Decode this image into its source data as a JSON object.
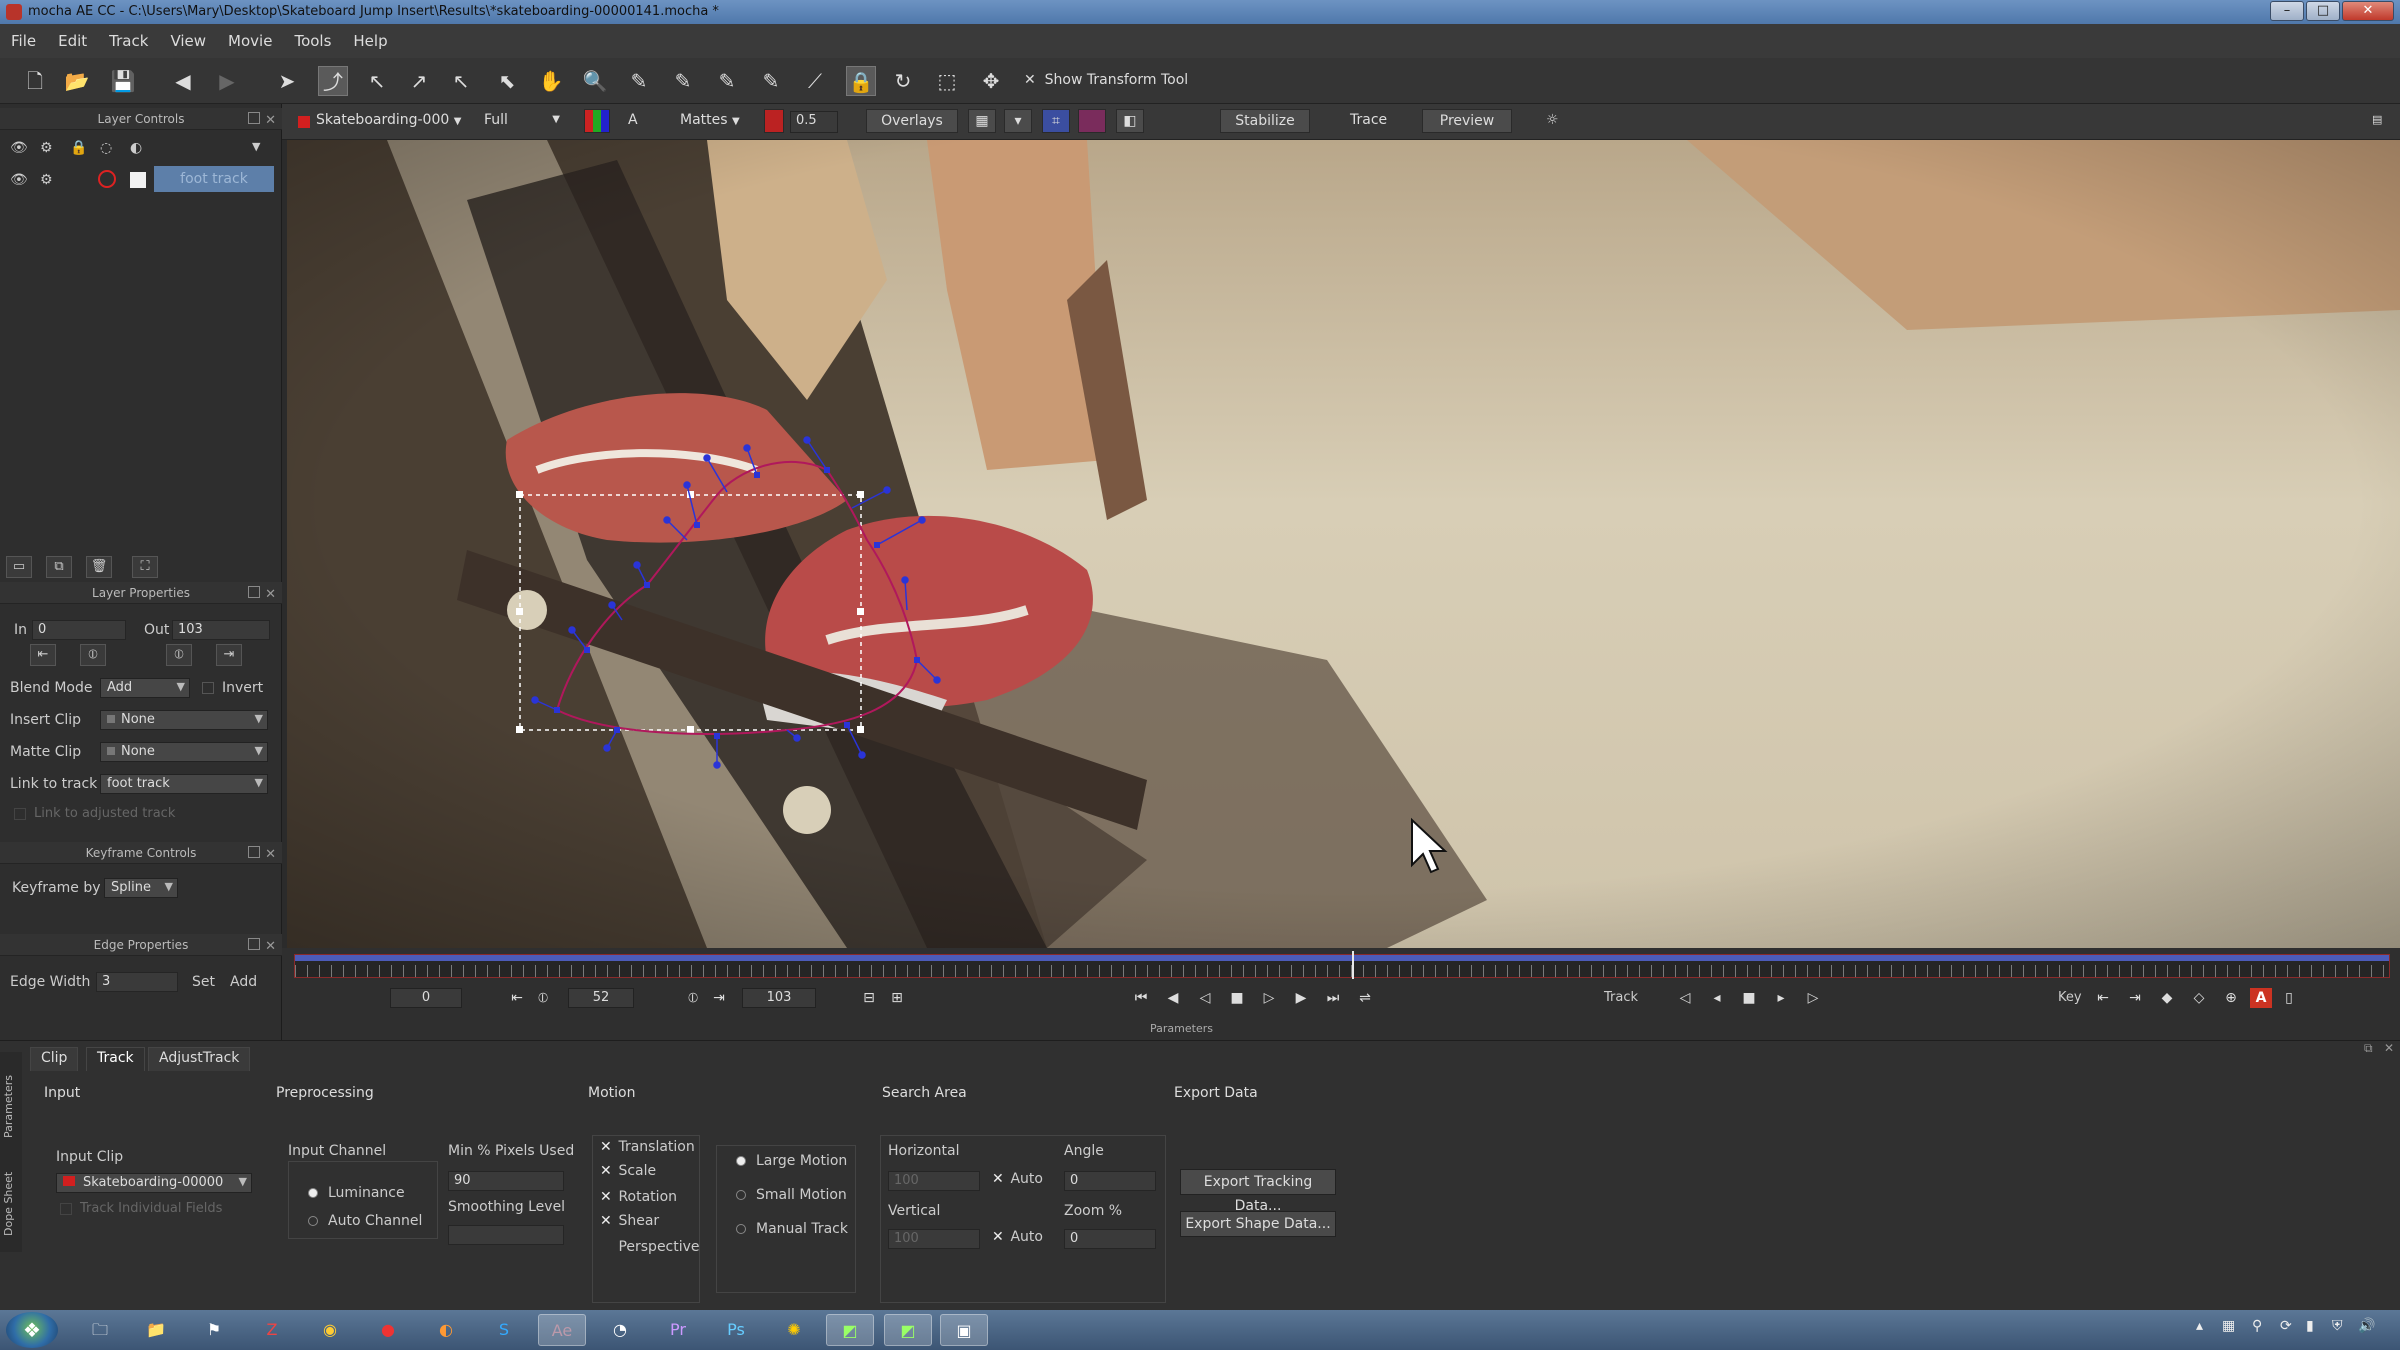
{
  "window": {
    "title": "mocha AE CC - C:\\Users\\Mary\\Desktop\\Skateboard Jump Insert\\Results\\*skateboarding-00000141.mocha *"
  },
  "menu": [
    "File",
    "Edit",
    "Track",
    "View",
    "Movie",
    "Tools",
    "Help"
  ],
  "toolbar": {
    "show_transform_tool": "Show Transform Tool"
  },
  "left": {
    "layer_controls": "Layer Controls",
    "layer_name": "foot track",
    "layer_properties": "Layer Properties",
    "in_label": "In",
    "in_value": "0",
    "out_label": "Out",
    "out_value": "103",
    "blend_mode_label": "Blend Mode",
    "blend_mode_value": "Add",
    "invert_label": "Invert",
    "insert_clip_label": "Insert Clip",
    "insert_clip_value": "None",
    "matte_clip_label": "Matte Clip",
    "matte_clip_value": "None",
    "link_to_track_label": "Link to track",
    "link_to_track_value": "foot track",
    "link_to_adjusted": "Link to adjusted track",
    "keyframe_controls": "Keyframe Controls",
    "keyframe_by_label": "Keyframe by",
    "keyframe_by_value": "Spline",
    "edge_properties": "Edge Properties",
    "edge_width_label": "Edge Width",
    "edge_width_value": "3",
    "set_label": "Set",
    "add_label": "Add"
  },
  "viewer": {
    "clip": "Skateboarding-000",
    "res": "Full",
    "mattes": "Mattes",
    "opacity": "0.5",
    "overlays": "Overlays",
    "stabilize": "Stabilize",
    "trace": "Trace",
    "preview": "Preview",
    "playhead_fraction": 0.505
  },
  "timeline": {
    "start": "0",
    "current": "52",
    "end": "103",
    "track_label": "Track",
    "key_label": "Key",
    "parameters_label": "Parameters"
  },
  "params": {
    "tabs": [
      "Clip",
      "Track",
      "AdjustTrack"
    ],
    "side_tabs": [
      "Parameters",
      "Dope Sheet"
    ],
    "input": "Input",
    "input_clip_label": "Input Clip",
    "input_clip_value": "Skateboarding-00000",
    "track_individual": "Track Individual Fields",
    "preprocessing": "Preprocessing",
    "input_channel": "Input Channel",
    "luminance": "Luminance",
    "auto_channel": "Auto Channel",
    "min_pixels_label": "Min % Pixels Used",
    "min_pixels_value": "90",
    "smoothing_label": "Smoothing Level",
    "smoothing_value": "",
    "motion": "Motion",
    "motion_checks": [
      "Translation",
      "Scale",
      "Rotation",
      "Shear",
      "Perspective"
    ],
    "motion_types": [
      "Large Motion",
      "Small Motion",
      "Manual Track"
    ],
    "search_area": "Search Area",
    "horizontal": "Horizontal",
    "horizontal_value": "100",
    "vertical": "Vertical",
    "vertical_value": "100",
    "auto": "Auto",
    "angle": "Angle",
    "angle_value": "0",
    "zoom": "Zoom %",
    "zoom_value": "0",
    "export_data": "Export Data",
    "export_tracking": "Export Tracking Data...",
    "export_shape": "Export Shape Data..."
  },
  "taskbar": {
    "icons": [
      "explorer-icon",
      "folder-icon",
      "app-icon",
      "filezilla-icon",
      "chrome-icon",
      "app-red-icon",
      "blender-icon",
      "skype-icon",
      "aftereffects-icon",
      "app-icon",
      "premiere-icon",
      "photoshop-icon",
      "app-icon",
      "mocha-icon",
      "mocha-icon",
      "mocha-icon"
    ]
  }
}
